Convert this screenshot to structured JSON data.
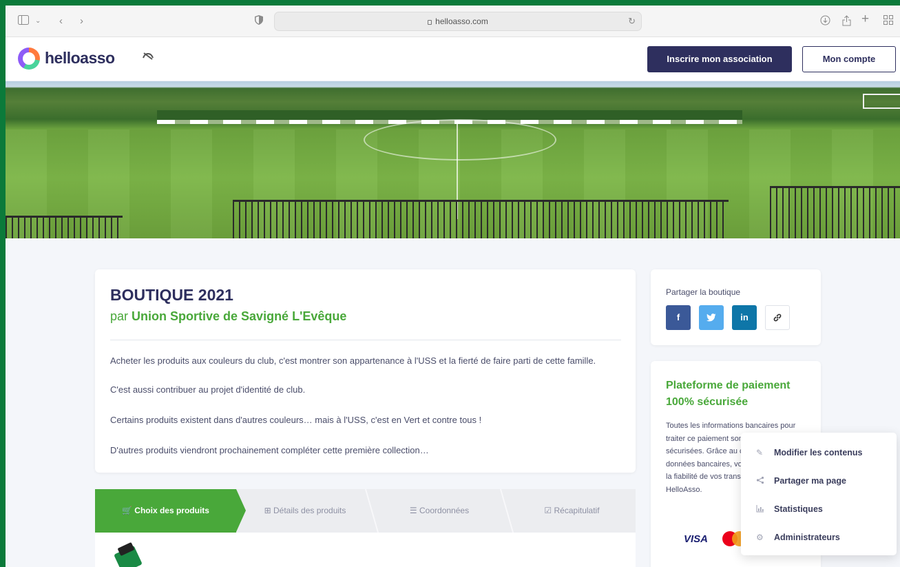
{
  "browser": {
    "url": "helloasso.com",
    "icons": [
      "sidebar-icon",
      "chevron-down-icon",
      "back-icon",
      "forward-icon",
      "privacy-shield-icon",
      "reload-icon",
      "download-icon",
      "share-icon",
      "new-tab-icon",
      "tab-overview-icon"
    ]
  },
  "header": {
    "logo_text": "helloasso",
    "register_button": "Inscrire mon association",
    "account_button": "Mon compte"
  },
  "campaign": {
    "title": "BOUTIQUE 2021",
    "by_prefix": "par",
    "organization": "Union Sportive de Savigné L'Evêque",
    "description": [
      "Acheter les produits aux couleurs du club, c'est montrer son appartenance à l'USS et la fierté de faire parti de cette famille.",
      "C'est aussi contribuer au projet d'identité de club.",
      "Certains produits existent dans d'autres couleurs… mais à l'USS, c'est en Vert et contre tous !",
      "D'autres produits viendront prochainement compléter cette première collection…"
    ]
  },
  "steps": [
    {
      "label": "Choix des produits",
      "icon": "cart-icon",
      "active": true
    },
    {
      "label": "Détails des produits",
      "icon": "tree-icon",
      "active": false
    },
    {
      "label": "Coordonnées",
      "icon": "list-icon",
      "active": false
    },
    {
      "label": "Récapitulatif",
      "icon": "checkbox-icon",
      "active": false
    }
  ],
  "share": {
    "title": "Partager la boutique",
    "buttons": [
      {
        "label": "f",
        "color": "#3b5998"
      },
      {
        "label": "t",
        "color": "#55acee"
      },
      {
        "label": "in",
        "color": "#0e76a8"
      }
    ]
  },
  "secure": {
    "title": "Plateforme de paiement 100% sécurisée",
    "text": "Toutes les informations bancaires pour traiter ce paiement sont totalement sécurisées. Grâce au cryptage SSL de vos données bancaires, vous êtes assurés de la fiabilité de vos transactions sur HelloAsso.",
    "visa": "VISA"
  },
  "context_menu": [
    {
      "label": "Modifier les contenus",
      "icon": "pencil-icon"
    },
    {
      "label": "Partager ma page",
      "icon": "share-icon"
    },
    {
      "label": "Statistiques",
      "icon": "chart-icon"
    },
    {
      "label": "Administrateurs",
      "icon": "gear-icon"
    }
  ],
  "colors": {
    "primary": "#2e2f5e",
    "accent_green": "#49a83a"
  }
}
